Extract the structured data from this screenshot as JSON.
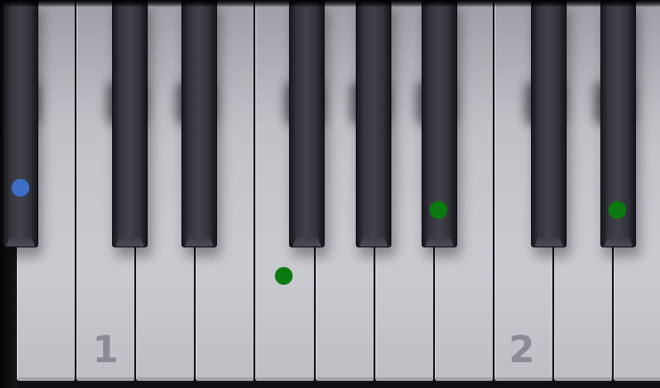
{
  "keyboard": {
    "octave_labels": [
      "1",
      "2"
    ],
    "colors": {
      "dot_blue": "#3d6fc7",
      "dot_green": "#0b7a10"
    },
    "markers": [
      {
        "key": "black-key-1",
        "color": "blue"
      },
      {
        "key": "white-key-5",
        "color": "green"
      },
      {
        "key": "black-key-6",
        "color": "green"
      },
      {
        "key": "black-key-8",
        "color": "green"
      }
    ]
  }
}
